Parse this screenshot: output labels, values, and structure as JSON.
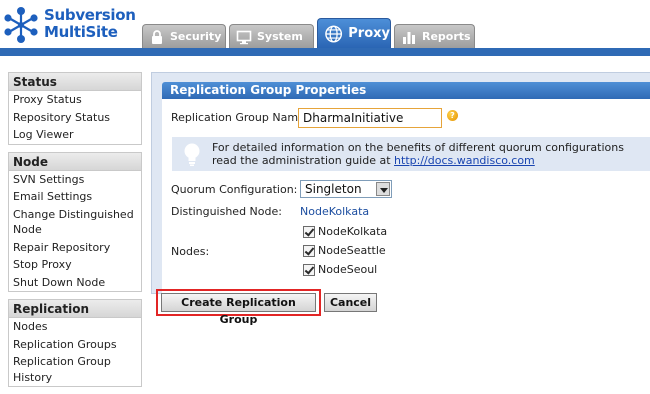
{
  "app": {
    "logo_line1": "Subversion",
    "logo_line2": "MultiSite"
  },
  "tabs": [
    {
      "label": "Security",
      "icon": "lock-icon",
      "active": false
    },
    {
      "label": "System",
      "icon": "monitor-icon",
      "active": false
    },
    {
      "label": "Proxy",
      "icon": "globe-icon",
      "active": true
    },
    {
      "label": "Reports",
      "icon": "bar-chart-icon",
      "active": false
    }
  ],
  "sidebar": {
    "status": {
      "title": "Status",
      "items": [
        "Proxy Status",
        "Repository Status",
        "Log Viewer"
      ]
    },
    "node": {
      "title": "Node",
      "items": [
        "SVN Settings",
        "Email Settings",
        "Change Distinguished Node",
        "Repair Repository",
        "Stop Proxy",
        "Shut Down Node"
      ]
    },
    "replication": {
      "title": "Replication",
      "items": [
        "Nodes",
        "Replication Groups",
        "Replication Group History"
      ]
    }
  },
  "form": {
    "title": "Replication Group Properties",
    "name_label": "Replication Group Name:",
    "name_value": "DharmaInitiative",
    "info_line1": "For detailed information on the benefits of different quorum configurations",
    "info_line2_prefix": "read the administration guide at ",
    "info_link": "http://docs.wandisco.com",
    "quorum_label": "Quorum Configuration:",
    "quorum_value": "Singleton",
    "distinguished_label": "Distinguished Node:",
    "distinguished_value": "NodeKolkata",
    "nodes_label": "Nodes:",
    "nodes": [
      {
        "name": "NodeKolkata",
        "checked": true
      },
      {
        "name": "NodeSeattle",
        "checked": true
      },
      {
        "name": "NodeSeoul",
        "checked": true
      }
    ]
  },
  "buttons": {
    "create": "Create Replication Group",
    "cancel": "Cancel"
  },
  "colors": {
    "brand_blue": "#2f6ab5",
    "highlight_outline": "#e22525",
    "input_border": "#e6a43a"
  }
}
